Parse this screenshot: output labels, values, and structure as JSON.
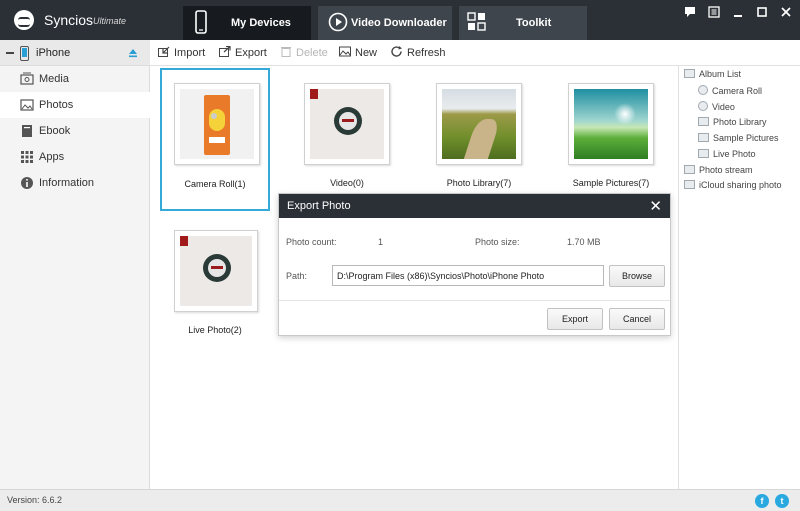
{
  "app": {
    "name": "Syncios",
    "edition": "Ultimate",
    "version": "Version: 6.6.2"
  },
  "nav": {
    "tabs": [
      {
        "label": "My Devices",
        "icon": "phone-icon",
        "active": true
      },
      {
        "label": "Video Downloader",
        "icon": "play-circle-icon",
        "active": false
      },
      {
        "label": "Toolkit",
        "icon": "grid-icon",
        "active": false
      }
    ]
  },
  "window_controls": [
    "chat-icon",
    "menu-icon",
    "minimize-icon",
    "maximize-icon",
    "close-icon"
  ],
  "device": {
    "name": "iPhone",
    "eject_icon": "eject-icon"
  },
  "toolbar": {
    "import": "Import",
    "export": "Export",
    "delete": "Delete",
    "new": "New",
    "refresh": "Refresh"
  },
  "sidebar": {
    "items": [
      {
        "label": "Media",
        "icon": "media-icon"
      },
      {
        "label": "Photos",
        "icon": "photos-icon",
        "active": true
      },
      {
        "label": "Ebook",
        "icon": "book-icon"
      },
      {
        "label": "Apps",
        "icon": "apps-grid-icon"
      },
      {
        "label": "Information",
        "icon": "info-icon"
      }
    ]
  },
  "albums": [
    {
      "label": "Camera Roll(1)"
    },
    {
      "label": "Video(0)"
    },
    {
      "label": "Photo Library(7)"
    },
    {
      "label": "Sample Pictures(7)"
    },
    {
      "label": "Live Photo(2)"
    }
  ],
  "album_list": {
    "header": "Album List",
    "items": [
      "Camera Roll",
      "Video",
      "Photo Library",
      "Sample Pictures",
      "Live Photo"
    ],
    "extra": [
      "Photo stream",
      "iCloud sharing photo"
    ]
  },
  "dialog": {
    "title": "Export Photo",
    "count_label": "Photo count:",
    "count_value": "1",
    "size_label": "Photo size:",
    "size_value": "1.70 MB",
    "path_label": "Path:",
    "path_value": "D:\\Program Files (x86)\\Syncios\\Photo\\iPhone Photo",
    "browse": "Browse",
    "export": "Export",
    "cancel": "Cancel"
  },
  "colors": {
    "titlebar": "#2b3036",
    "selected_border": "#35a9d8",
    "social": "#29a9e0"
  }
}
